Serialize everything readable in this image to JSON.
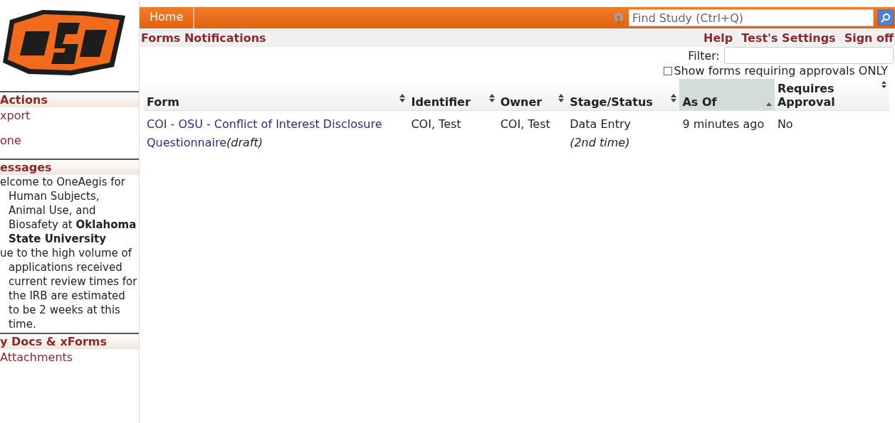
{
  "sidebar": {
    "sections": [
      {
        "title": "Actions",
        "items": [
          {
            "kind": "link",
            "text": "xport"
          },
          {
            "kind": "link",
            "text": "one"
          }
        ]
      },
      {
        "title": "essages",
        "items": [
          {
            "kind": "message",
            "text": "elcome to OneAegis for Human Subjects, Animal Use, and Biosafety at **Oklahoma State University**"
          },
          {
            "kind": "message",
            "text": "ue to the high volume of applications received current review times for the IRB are estimated to be 2 weeks at this time."
          }
        ]
      },
      {
        "title": "y Docs & xForms",
        "items": [
          {
            "kind": "link",
            "text": "Attachments"
          }
        ]
      }
    ]
  },
  "top_bar": {
    "tabs": [
      {
        "label": "Home"
      }
    ],
    "search": {
      "placeholder": "Find Study (Ctrl+Q)"
    }
  },
  "page_title": "Forms Notifications",
  "links": [
    "Help",
    "Test's Settings",
    "Sign off"
  ],
  "filter": {
    "label": "Filter:"
  },
  "approvals_only": {
    "label": "Show forms requiring approvals ONLY",
    "checked": false
  },
  "table": {
    "columns": [
      {
        "label": "Form",
        "sorted": false
      },
      {
        "label": "Identifier",
        "sorted": false
      },
      {
        "label": "Owner",
        "sorted": false
      },
      {
        "label": "Stage/Status",
        "sorted": false
      },
      {
        "label": "As Of",
        "sorted": true
      },
      {
        "label": "Requires Approval",
        "sorted": false
      }
    ],
    "rows": [
      {
        "form": "COI - OSU - Conflict of Interest Disclosure Questionnaire",
        "form_note": "(draft)",
        "identifier": "COI, Test",
        "owner": "COI, Test",
        "stage": "Data Entry",
        "stage_note": "(2nd time)",
        "as_of": "9 minutes ago",
        "requires_approval": "No"
      }
    ]
  }
}
